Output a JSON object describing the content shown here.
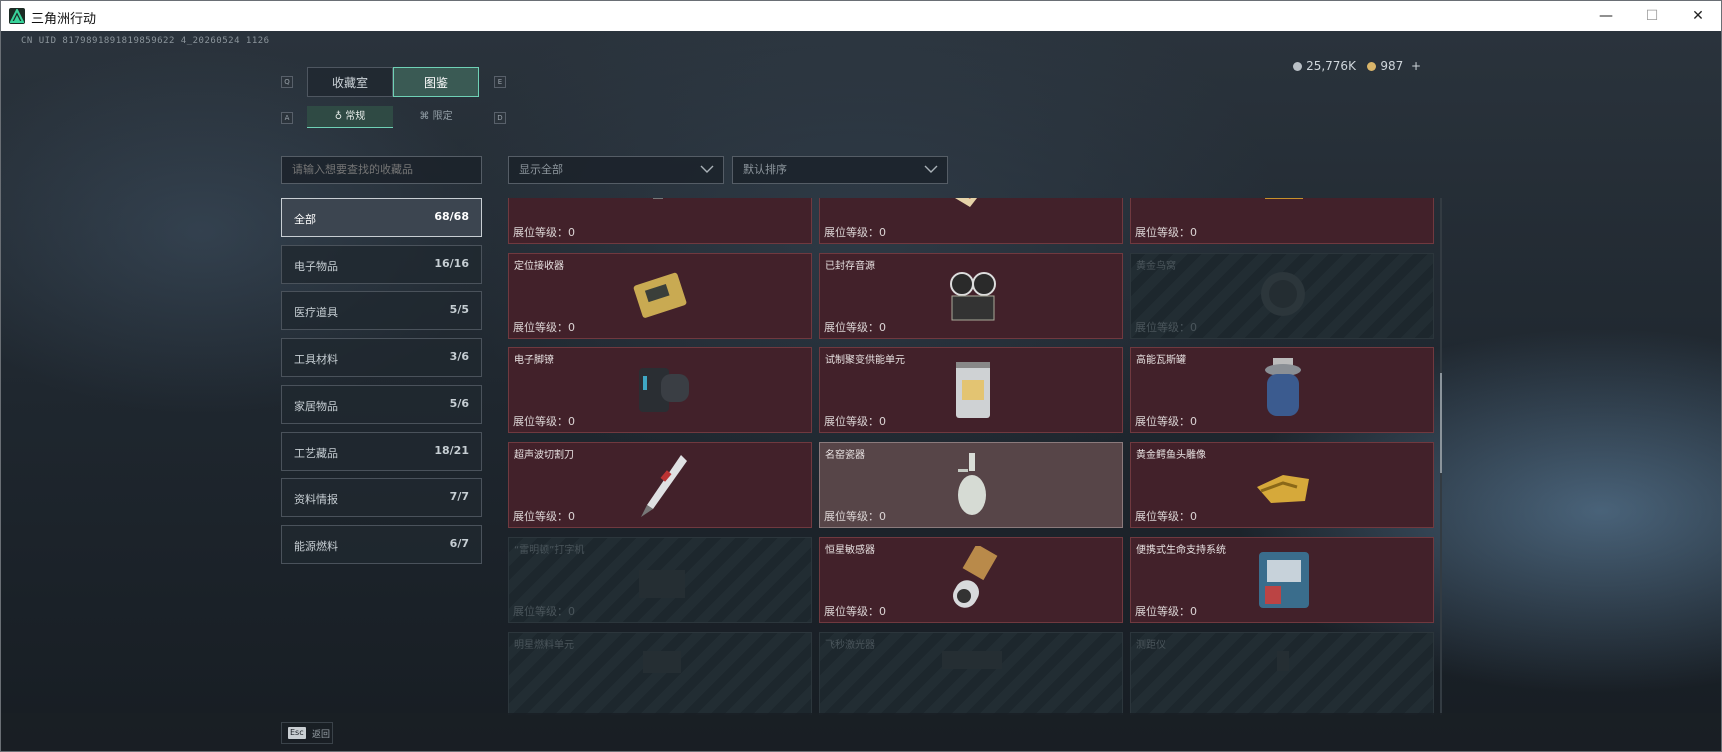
{
  "window": {
    "title": "三角洲行动",
    "min": "—",
    "max": "☐",
    "close": "✕"
  },
  "uid": "CN UID 8179891891819859622 4_20260524 1126",
  "tabs": [
    {
      "label": "收藏室",
      "key": "Q"
    },
    {
      "label": "图鉴",
      "key": "E"
    }
  ],
  "subtabs": [
    {
      "label": "常规",
      "key": "A"
    },
    {
      "label": "限定",
      "key": "D"
    }
  ],
  "currency": {
    "silver": "25,776K",
    "gold": "987",
    "plus": "+"
  },
  "search": {
    "placeholder": "请输入想要查找的收藏品"
  },
  "filter": {
    "value": "显示全部"
  },
  "sort": {
    "value": "默认排序"
  },
  "categories": [
    {
      "label": "全部",
      "count": "68/68"
    },
    {
      "label": "电子物品",
      "count": "16/16"
    },
    {
      "label": "医疗道具",
      "count": "5/5"
    },
    {
      "label": "工具材料",
      "count": "3/6"
    },
    {
      "label": "家居物品",
      "count": "5/6"
    },
    {
      "label": "工艺藏品",
      "count": "18/21"
    },
    {
      "label": "资料情报",
      "count": "7/7"
    },
    {
      "label": "能源燃料",
      "count": "6/7"
    }
  ],
  "level_prefix": "展位等级：",
  "items": [
    {
      "name": "",
      "level": "0",
      "icon": "mechanical-part-icon",
      "state": "owned"
    },
    {
      "name": "",
      "level": "0",
      "icon": "painting-scroll-icon",
      "state": "owned"
    },
    {
      "name": "",
      "level": "0",
      "icon": "gold-frame-painting-icon",
      "state": "owned"
    },
    {
      "name": "定位接收器",
      "level": "0",
      "icon": "receiver-device-icon",
      "state": "owned"
    },
    {
      "name": "已封存音源",
      "level": "0",
      "icon": "reel-recorder-icon",
      "state": "owned"
    },
    {
      "name": "黄金鸟窝",
      "level": "0",
      "icon": "bird-nest-icon",
      "state": "locked"
    },
    {
      "name": "电子脚镣",
      "level": "0",
      "icon": "ankle-monitor-icon",
      "state": "owned"
    },
    {
      "name": "试制聚变供能单元",
      "level": "0",
      "icon": "fusion-unit-icon",
      "state": "owned"
    },
    {
      "name": "高能瓦斯罐",
      "level": "0",
      "icon": "gas-canister-icon",
      "state": "owned"
    },
    {
      "name": "超声波切割刀",
      "level": "0",
      "icon": "ultrasonic-knife-icon",
      "state": "owned"
    },
    {
      "name": "名窑瓷器",
      "level": "0",
      "icon": "porcelain-vase-icon",
      "state": "highlighted"
    },
    {
      "name": "黄金鳄鱼头雕像",
      "level": "0",
      "icon": "gold-crocodile-icon",
      "state": "owned"
    },
    {
      "name": "“雷明顿”打字机",
      "level": "0",
      "icon": "typewriter-icon",
      "state": "locked"
    },
    {
      "name": "恒星敏感器",
      "level": "0",
      "icon": "star-sensor-icon",
      "state": "owned"
    },
    {
      "name": "便携式生命支持系统",
      "level": "0",
      "icon": "life-support-icon",
      "state": "owned"
    },
    {
      "name": "明星燃料单元",
      "level": "",
      "icon": "fuel-cell-icon",
      "state": "locked"
    },
    {
      "name": "飞秒激光器",
      "level": "",
      "icon": "laser-icon",
      "state": "locked"
    },
    {
      "name": "测距仪",
      "level": "",
      "icon": "rangefinder-icon",
      "state": "locked"
    }
  ],
  "footer": {
    "key": "Esc",
    "label": "返回"
  },
  "colors": {
    "accent": "#6fd1b6",
    "owned_card": "#42212a",
    "locked_card": "#1d272d",
    "highlight_card": "#574548"
  }
}
